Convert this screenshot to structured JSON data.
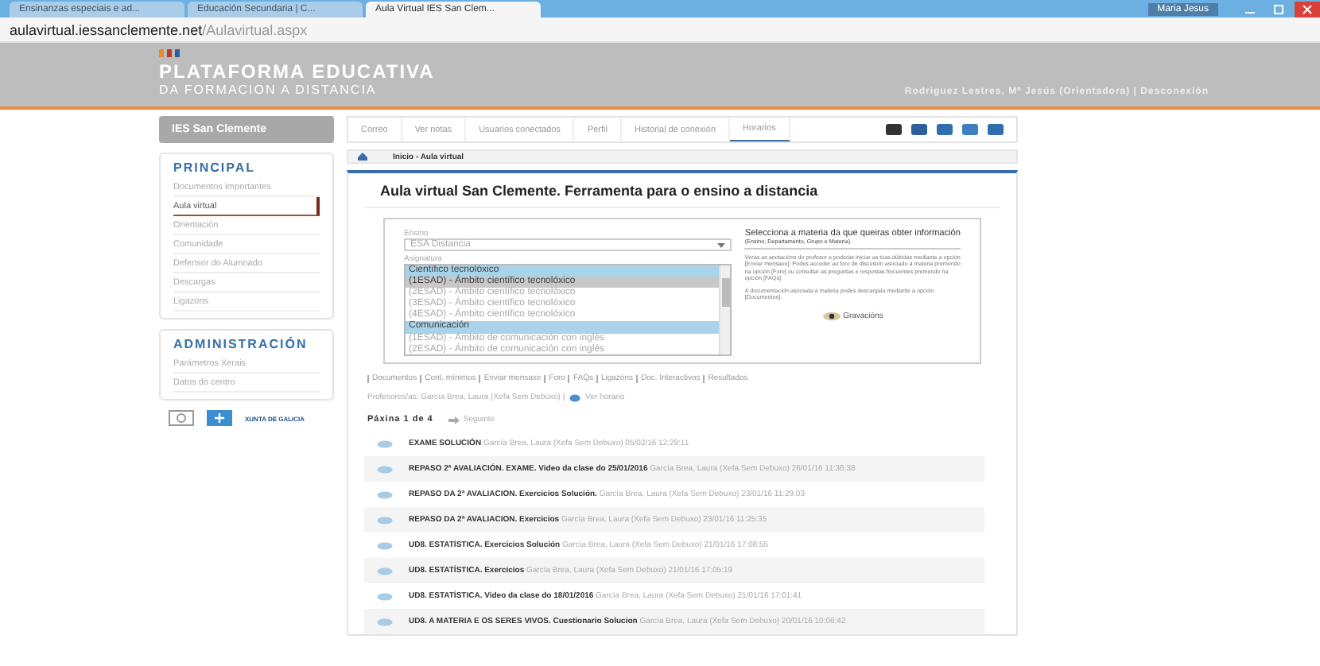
{
  "browser": {
    "tabs": [
      {
        "label": "Ensinanzas especiais e ad...",
        "selected": false
      },
      {
        "label": "Educación Secundaria | C...",
        "selected": false
      },
      {
        "label": "Aula Virtual IES San Clem...",
        "selected": true
      }
    ],
    "user": "Maria Jesus",
    "url_host": "aulavirtual.iessanclemente.net",
    "url_path": "/Aulavirtual.aspx"
  },
  "header": {
    "title": "PLATAFORMA EDUCATIVA",
    "subtitle": "DA FORMACION A DISTANCIA",
    "user_line": "Rodriguez Lestres, Mª Jesús (Orientadora) | Desconexión"
  },
  "sidebar": {
    "school": "IES San Clemente",
    "sections": [
      {
        "title": "PRINCIPAL",
        "items": [
          {
            "label": "Documentos Importantes",
            "selected": false
          },
          {
            "label": "Aula virtual",
            "selected": true
          },
          {
            "label": "Orientación",
            "selected": false
          },
          {
            "label": "Comunidade",
            "selected": false
          },
          {
            "label": "Defensor do Alumnado",
            "selected": false
          },
          {
            "label": "Descargas",
            "selected": false
          },
          {
            "label": "Ligazóns",
            "selected": false
          }
        ]
      },
      {
        "title": "ADMINISTRACIÓN",
        "items": [
          {
            "label": "Parámetros Xerais",
            "selected": false
          },
          {
            "label": "Datos do centro",
            "selected": false
          }
        ]
      }
    ],
    "logo_text": "XUNTA DE GALICIA"
  },
  "nav": {
    "tabs": [
      {
        "label": "Correo",
        "selected": false
      },
      {
        "label": "Ver notas",
        "selected": false
      },
      {
        "label": "Usuarios conectados",
        "selected": false
      },
      {
        "label": "Perfil",
        "selected": false
      },
      {
        "label": "Historial de conexión",
        "selected": false
      },
      {
        "label": "Horarios",
        "selected": true
      }
    ]
  },
  "breadcrumb": "Inicio  -  Aula virtual",
  "page_title": "Aula virtual San Clemente. Ferramenta para o ensino a distancia",
  "form": {
    "ensino_label": "Ensino",
    "ensino_value": "ESA Distancia",
    "asignatura_label": "Asignatura",
    "options": [
      {
        "kind": "group",
        "label": "Científico tecnolóxico",
        "selected": false
      },
      {
        "kind": "option",
        "label": "(1ESAD) - Ámbito científico tecnolóxico",
        "selected": true
      },
      {
        "kind": "option",
        "label": "(2ESAD) - Ámbito científico tecnolóxico",
        "selected": false
      },
      {
        "kind": "option",
        "label": "(3ESAD) - Ámbito científico tecnolóxico",
        "selected": false
      },
      {
        "kind": "option",
        "label": "(4ESAD) - Ámbito científico tecnolóxico",
        "selected": false
      },
      {
        "kind": "group",
        "label": "Comunicación",
        "selected": false
      },
      {
        "kind": "option",
        "label": "(1ESAD) - Ámbito de comunicación con inglés",
        "selected": false
      },
      {
        "kind": "option",
        "label": "(2ESAD) - Ámbito de comunicación con inglés",
        "selected": false
      }
    ],
    "info_title": "Selecciona a materia da que queiras obter información",
    "info_sub": "(Ensino, Departamento, Grupo e Materia).",
    "info_p1": "Verás as anotacións do profesor e poderás iniciar as túas dúbidas mediante a opción [Enviar mensaxe]. Podes acceder ao foro de discusión asociado á materia premendo na opción [Foro] ou consultar as preguntas e respostas frecuentes premendo na opción [FAQs].",
    "info_p2": "A documentación asociada á materia podes descargala mediante a opción [Documentos].",
    "recordings": "Gravacións"
  },
  "links": [
    "Documentos",
    "Cont. mínimos",
    "Enviar mensaxe",
    "Foro",
    "FAQs",
    "Ligazóns",
    "Doc. Interactivos",
    "Resultados"
  ],
  "teachers_label": "Profesores/as: García Brea, Laura (Xefa Sem Debuxo) |",
  "schedule_link": "Ver horario",
  "pagination": {
    "page": "Páxina 1 de 4",
    "next": "Seguinte"
  },
  "entries": [
    {
      "title": "EXAME SOLUCIÓN",
      "meta": "García Brea, Laura (Xefa Sem Debuxo) 05/02/16 12:29:11"
    },
    {
      "title": "REPASO 2ª AVALIACIÓN. EXAME. Video da clase do 25/01/2016",
      "meta": "García Brea, Laura (Xefa Sem Debuxo) 26/01/16 11:36:38"
    },
    {
      "title": "REPASO DA 2ª AVALIACION. Exercicios Solución.",
      "meta": "García Brea, Laura (Xefa Sem Debuxo) 23/01/16 11:29:03"
    },
    {
      "title": "REPASO DA 2ª AVALIACION. Exercicios",
      "meta": "García Brea, Laura (Xefa Sem Debuxo) 23/01/16 11:25:35"
    },
    {
      "title": "UD8. ESTATÍSTICA. Exercicios Solución",
      "meta": "García Brea, Laura (Xefa Sem Debuxo) 21/01/16 17:08:55"
    },
    {
      "title": "UD8. ESTATÍSTICA. Exercicios",
      "meta": "García Brea, Laura (Xefa Sem Debuxo) 21/01/16 17:05:19"
    },
    {
      "title": "UD8. ESTATÍSTICA. Video da clase do 18/01/2016",
      "meta": "García Brea, Laura (Xefa Sem Debuxo) 21/01/16 17:01:41"
    },
    {
      "title": "UD8. A MATERIA E OS SERES VIVOS. Cuestionario Solucion",
      "meta": "García Brea, Laura (Xefa Sem Debuxo) 20/01/16 10:06:42"
    }
  ]
}
